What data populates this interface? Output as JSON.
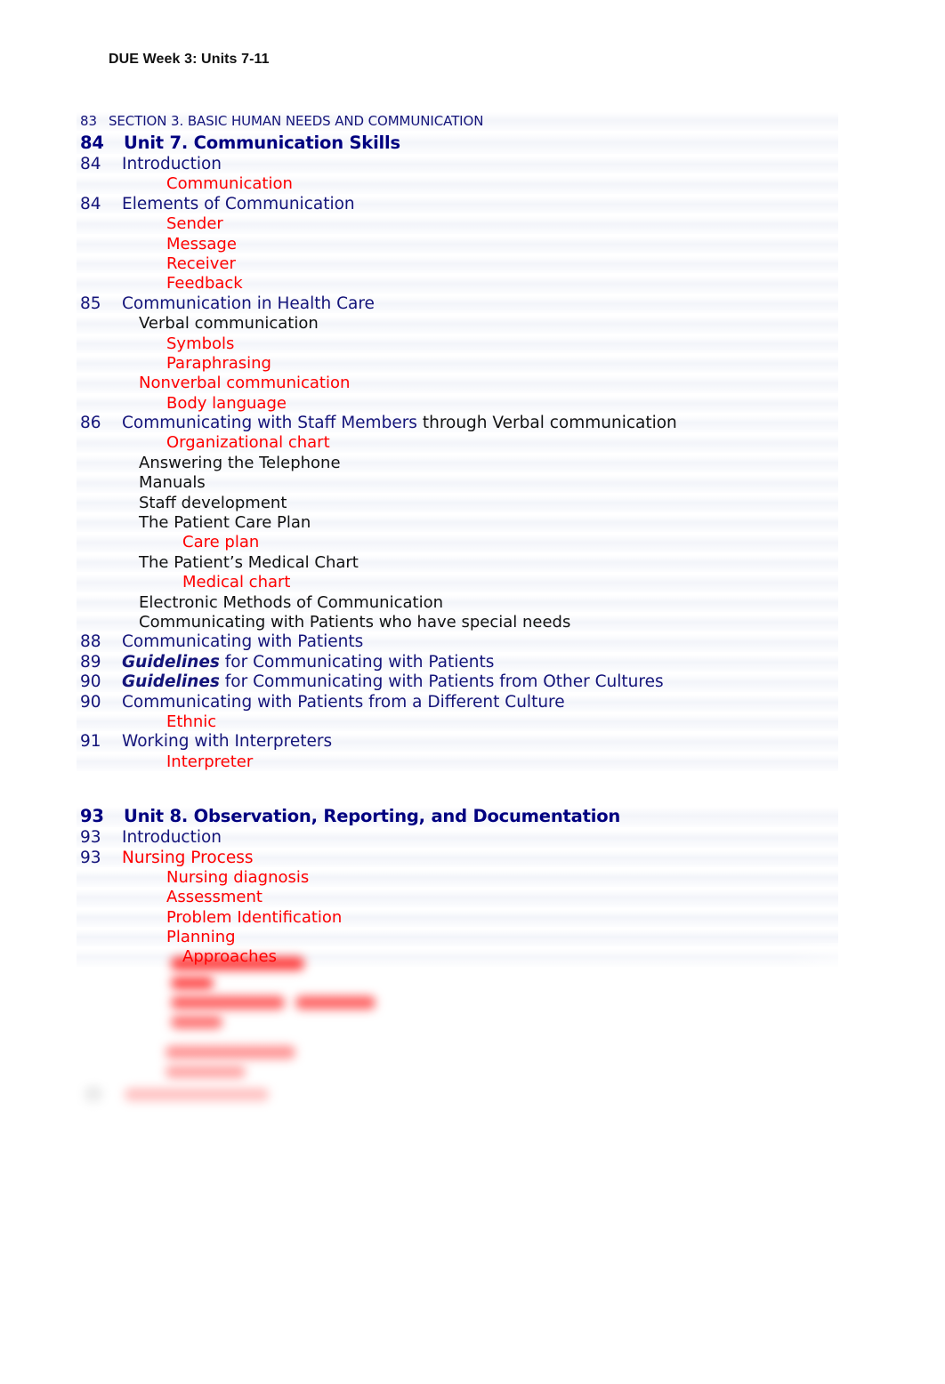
{
  "document": {
    "header": "DUE Week 3: Units 7-11",
    "colors": {
      "heading_blue": "#14147a",
      "unit_navy": "#000080",
      "term_red": "#fe0000",
      "body_black": "#111111",
      "page_background": "#ffffff"
    }
  },
  "toc": {
    "section": {
      "page": "83",
      "label": "SECTION 3. BASIC HUMAN NEEDS AND COMMUNICATION"
    },
    "units": [
      {
        "page": "84",
        "title": "Unit 7. Communication Skills",
        "entries": [
          {
            "page": "84",
            "title": "Introduction",
            "style": "blue",
            "indent": "title"
          },
          {
            "page": "",
            "title": "Communication",
            "style": "red",
            "indent": "sub2"
          },
          {
            "page": "84",
            "title": "Elements of Communication",
            "style": "blue",
            "indent": "title"
          },
          {
            "page": "",
            "title": "Sender",
            "style": "red",
            "indent": "sub2"
          },
          {
            "page": "",
            "title": "Message",
            "style": "red",
            "indent": "sub2"
          },
          {
            "page": "",
            "title": "Receiver",
            "style": "red",
            "indent": "sub2"
          },
          {
            "page": "",
            "title": "Feedback",
            "style": "red",
            "indent": "sub2"
          },
          {
            "page": "85",
            "title": "Communication in Health Care",
            "style": "blue",
            "indent": "title"
          },
          {
            "page": "",
            "title": "Verbal communication",
            "style": "black",
            "indent": "sub"
          },
          {
            "page": "",
            "title": "Symbols",
            "style": "red",
            "indent": "sub2"
          },
          {
            "page": "",
            "title": "Paraphrasing",
            "style": "red",
            "indent": "sub2"
          },
          {
            "page": "",
            "title": "Nonverbal communication",
            "style": "red",
            "indent": "sub"
          },
          {
            "page": "",
            "title": "Body language",
            "style": "red",
            "indent": "sub2"
          },
          {
            "page": "86",
            "title": "Communicating with Staff Members",
            "title_tail": " through Verbal communication",
            "style": "blue",
            "tail_style": "black",
            "indent": "title"
          },
          {
            "page": "",
            "title": "Organizational chart",
            "style": "red",
            "indent": "sub2"
          },
          {
            "page": "",
            "title": "Answering the Telephone",
            "style": "black",
            "indent": "sub"
          },
          {
            "page": "",
            "title": "Manuals",
            "style": "black",
            "indent": "sub"
          },
          {
            "page": "",
            "title": "Staff development",
            "style": "black",
            "indent": "sub"
          },
          {
            "page": "",
            "title": "The Patient Care Plan",
            "style": "black",
            "indent": "sub"
          },
          {
            "page": "",
            "title": "Care plan",
            "style": "red",
            "indent": "sub3"
          },
          {
            "page": "",
            "title": "The Patient’s Medical Chart",
            "style": "black",
            "indent": "sub"
          },
          {
            "page": "",
            "title": "Medical chart",
            "style": "red",
            "indent": "sub3"
          },
          {
            "page": "",
            "title": "Electronic Methods of Communication",
            "style": "black",
            "indent": "sub"
          },
          {
            "page": "",
            "title": "Communicating with Patients who have special needs",
            "style": "black",
            "indent": "sub"
          },
          {
            "page": "88",
            "title": "Communicating with Patients",
            "style": "blue",
            "indent": "title"
          },
          {
            "page": "89",
            "title_lead": "Guidelines",
            "title": " for Communicating with Patients",
            "style": "blue",
            "indent": "title"
          },
          {
            "page": "90",
            "title_lead": "Guidelines",
            "title": " for Communicating with Patients from Other Cultures",
            "style": "blue",
            "indent": "title"
          },
          {
            "page": "90",
            "title": "Communicating with Patients from a Different Culture",
            "style": "blue",
            "indent": "title"
          },
          {
            "page": "",
            "title": "Ethnic",
            "style": "red",
            "indent": "sub2"
          },
          {
            "page": "91",
            "title": "Working with Interpreters",
            "style": "blue",
            "indent": "title"
          },
          {
            "page": "",
            "title": "Interpreter",
            "style": "red",
            "indent": "sub2"
          }
        ]
      },
      {
        "page": "93",
        "title": "Unit 8. Observation, Reporting, and Documentation",
        "entries": [
          {
            "page": "93",
            "title": "Introduction",
            "style": "blue",
            "indent": "title"
          },
          {
            "page": "93",
            "title": "Nursing Process",
            "style": "red",
            "indent": "title"
          },
          {
            "page": "",
            "title": "Nursing diagnosis",
            "style": "red",
            "indent": "sub2"
          },
          {
            "page": "",
            "title": "Assessment",
            "style": "red",
            "indent": "sub2"
          },
          {
            "page": "",
            "title": "Problem Identification",
            "style": "red",
            "indent": "sub2"
          },
          {
            "page": "",
            "title": "Planning",
            "style": "red",
            "indent": "sub2"
          },
          {
            "page": "",
            "title": "Approaches",
            "style": "red",
            "indent": "sub3"
          }
        ]
      }
    ],
    "obscured_tail": {
      "note": "Remaining lines are blurred and faded beyond legibility in the source image.",
      "line_count": 8
    }
  }
}
